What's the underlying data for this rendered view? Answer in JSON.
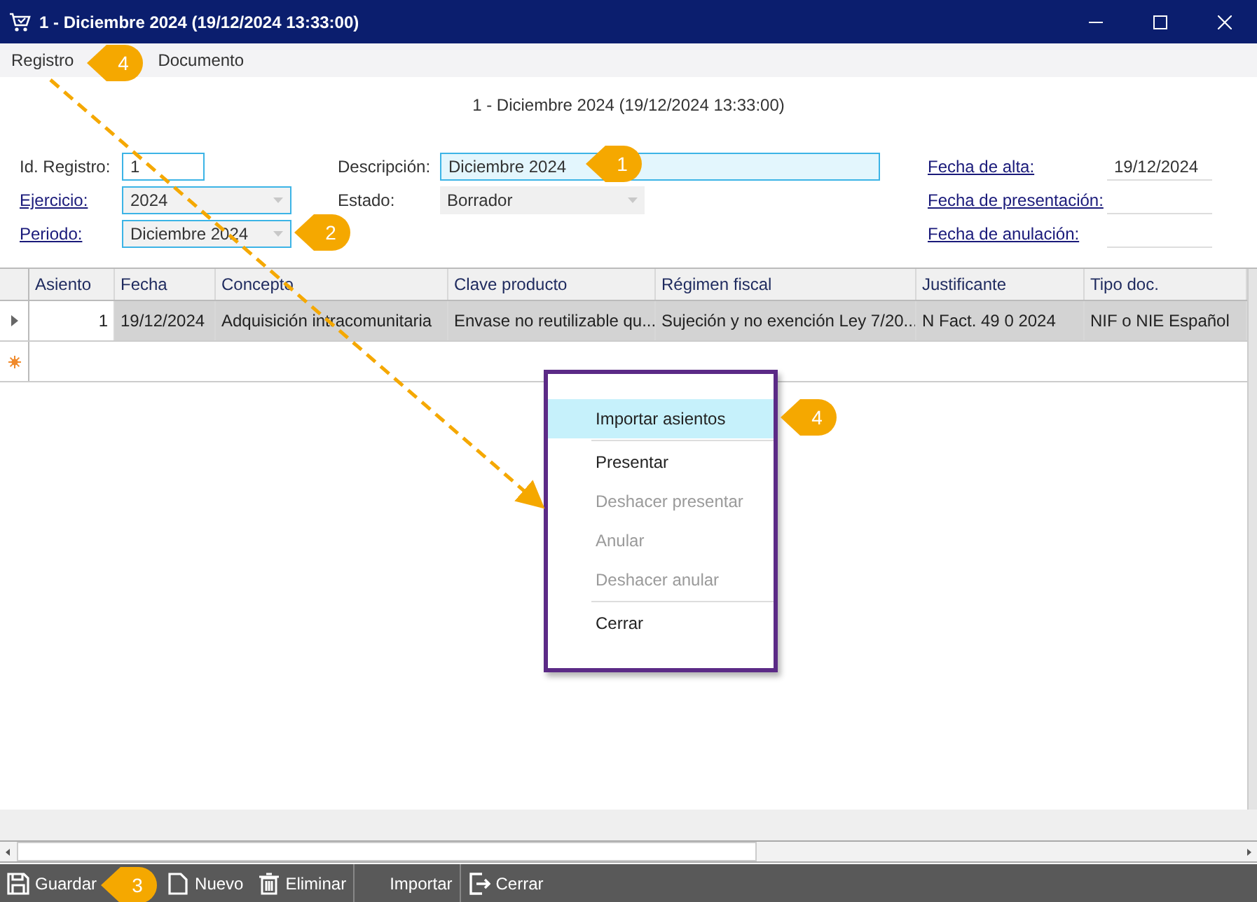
{
  "window": {
    "title": "1 - Diciembre 2024 (19/12/2024 13:33:00)"
  },
  "menu": [
    {
      "label": "Registro"
    },
    {
      "label": "Documento"
    }
  ],
  "heading": "1 - Diciembre 2024 (19/12/2024 13:33:00)",
  "form": {
    "columns": [
      [
        {
          "label": "Id. Registro:",
          "link": false,
          "kind": "text",
          "value": "1",
          "focused": false
        },
        {
          "label": "Ejercicio:",
          "link": true,
          "kind": "combo",
          "value": "2024",
          "focused": false
        },
        {
          "label": "Periodo:",
          "link": true,
          "kind": "combo",
          "value": "Diciembre 2024",
          "focused": false
        }
      ],
      [
        {
          "label": "Descripción:",
          "link": false,
          "kind": "text",
          "value": "Diciembre 2024",
          "focused": true
        },
        {
          "label": "Estado:",
          "link": false,
          "kind": "readonly-combo",
          "value": "Borrador",
          "focused": false
        }
      ],
      [
        {
          "label": "Fecha de alta:",
          "link": true,
          "kind": "date",
          "value": "19/12/2024",
          "focused": false
        },
        {
          "label": "Fecha de presentación:",
          "link": true,
          "kind": "date",
          "focused": false
        },
        {
          "label": "Fecha de anulación:",
          "link": true,
          "kind": "date",
          "focused": false
        }
      ]
    ]
  },
  "table": {
    "columns": [
      "Asiento",
      "Fecha",
      "Concepto",
      "Clave producto",
      "Régimen fiscal",
      "Justificante",
      "Tipo doc."
    ],
    "rows": [
      {
        "selected": true,
        "cells": [
          "1",
          "19/12/2024",
          "Adquisición intracomunitaria",
          "Envase no reutilizable qu...",
          "Sujeción y no exención Ley 7/20...",
          "N Fact. 49 0 2024",
          "NIF o NIE Español"
        ]
      }
    ],
    "new_row": true
  },
  "context_menu": {
    "groups": [
      [
        {
          "label": "Importar asientos",
          "selected": true,
          "disabled": false
        }
      ],
      [
        {
          "label": "Presentar",
          "selected": false,
          "disabled": false
        },
        {
          "label": "Deshacer presentar",
          "selected": false,
          "disabled": true
        },
        {
          "label": "Anular",
          "selected": false,
          "disabled": true
        },
        {
          "label": "Deshacer anular",
          "selected": false,
          "disabled": true
        }
      ],
      [
        {
          "label": "Cerrar",
          "selected": false,
          "disabled": false
        }
      ]
    ]
  },
  "toolbar": {
    "groups": [
      [
        {
          "label": "Guardar",
          "kind": "save"
        },
        {
          "label": "Nuevo",
          "kind": "new"
        },
        {
          "label": "Eliminar",
          "kind": "trash"
        }
      ],
      [
        {
          "label": "Importar",
          "kind": "blank"
        }
      ],
      [
        {
          "label": "Cerrar",
          "kind": "exit"
        }
      ]
    ]
  },
  "callouts": [
    "4",
    "1",
    "2",
    "4",
    "3"
  ]
}
